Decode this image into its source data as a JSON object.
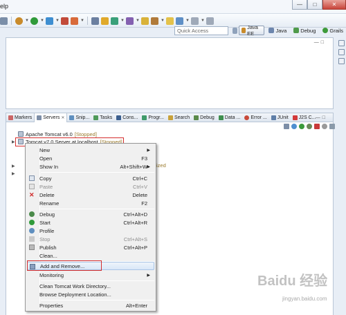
{
  "menubar": {
    "menu_fragment": "elp"
  },
  "toolbar": {
    "quick_access_placeholder": "Quick Access",
    "perspectives": [
      {
        "label": "Java EE",
        "icon": "java-ee-icon",
        "active": true
      },
      {
        "label": "Java",
        "icon": "java-icon",
        "active": false
      },
      {
        "label": "Debug",
        "icon": "debug-icon",
        "active": false
      },
      {
        "label": "Grails",
        "icon": "grails-icon",
        "active": false
      }
    ]
  },
  "views": {
    "tabs": [
      {
        "label": "Markers",
        "icon": "markers-icon"
      },
      {
        "label": "Servers",
        "icon": "servers-icon",
        "active": true
      },
      {
        "label": "Snip...",
        "icon": "snippets-icon"
      },
      {
        "label": "Tasks",
        "icon": "tasks-icon"
      },
      {
        "label": "Cons...",
        "icon": "console-icon"
      },
      {
        "label": "Progr...",
        "icon": "progress-icon"
      },
      {
        "label": "Search",
        "icon": "search-icon"
      },
      {
        "label": "Debug",
        "icon": "debug-icon"
      },
      {
        "label": "Data ...",
        "icon": "data-icon"
      },
      {
        "label": "Error ...",
        "icon": "error-icon"
      },
      {
        "label": "JUnit",
        "icon": "junit-icon"
      },
      {
        "label": "J2S C...",
        "icon": "j2s-icon"
      }
    ]
  },
  "servers": [
    {
      "name": "Apache Tomcat v6.0",
      "state": "[Stopped]"
    },
    {
      "name": "Tomcat v7.0 Server at localhost",
      "state": "[Stopped]",
      "selected": true
    }
  ],
  "obscured_state_text": "ized",
  "context_menu": {
    "items": [
      {
        "label": "New",
        "submenu": true
      },
      {
        "label": "Open",
        "accel": "F3"
      },
      {
        "label": "Show In",
        "accel": "Alt+Shift+W",
        "submenu": true
      },
      {
        "separator": true
      },
      {
        "label": "Copy",
        "accel": "Ctrl+C",
        "icon": "copy-icon"
      },
      {
        "label": "Paste",
        "accel": "Ctrl+V",
        "icon": "paste-icon",
        "disabled": true
      },
      {
        "label": "Delete",
        "accel": "Delete",
        "icon": "delete-icon"
      },
      {
        "label": "Rename",
        "accel": "F2"
      },
      {
        "separator": true
      },
      {
        "label": "Debug",
        "accel": "Ctrl+Alt+D",
        "icon": "debug-icon"
      },
      {
        "label": "Start",
        "accel": "Ctrl+Alt+R",
        "icon": "start-icon"
      },
      {
        "label": "Profile",
        "icon": "profile-icon"
      },
      {
        "label": "Stop",
        "accel": "Ctrl+Alt+S",
        "icon": "stop-icon",
        "disabled": true
      },
      {
        "label": "Publish",
        "accel": "Ctrl+Alt+P",
        "icon": "publish-icon"
      },
      {
        "label": "Clean..."
      },
      {
        "separator": true
      },
      {
        "label": "Add and Remove...",
        "highlighted": true
      },
      {
        "label": "Monitoring",
        "submenu": true
      },
      {
        "separator": true
      },
      {
        "label": "Clean Tomcat Work Directory..."
      },
      {
        "label": "Browse Deployment Location..."
      },
      {
        "separator": true
      },
      {
        "label": "Properties",
        "accel": "Alt+Enter"
      }
    ]
  },
  "watermark": {
    "text": "Baidu 经验",
    "sub": "jingyan.baidu.com"
  },
  "colors": {
    "highlight_box": "#d42c2c",
    "state_text": "#9a7a2c",
    "selection": "#d9e7f7"
  }
}
